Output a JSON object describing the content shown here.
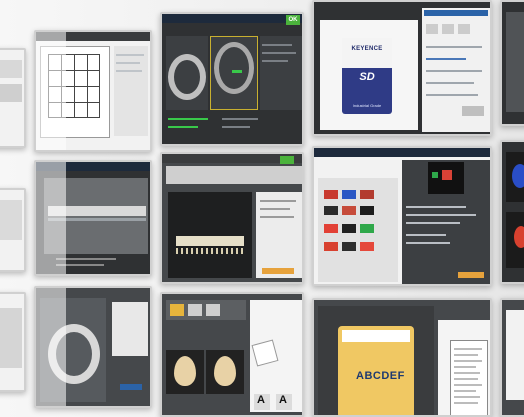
{
  "ok_badge": "OK",
  "sd_card": {
    "brand": "KEYENCE",
    "logo": "SD",
    "subtitle": "Industrial Grade"
  },
  "label_text": "ABCDEF",
  "glyph_a": "A"
}
